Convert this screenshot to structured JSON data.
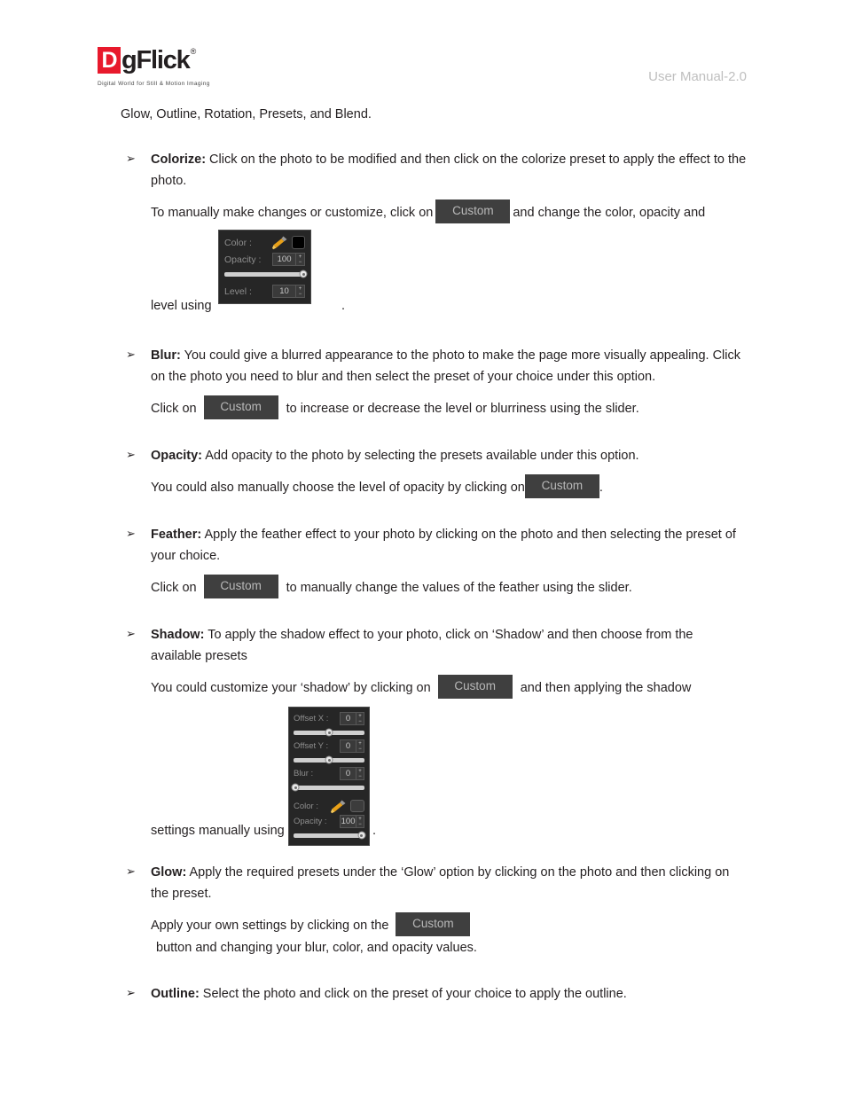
{
  "header": {
    "logo_letter": "D",
    "logo_text": "gFlick",
    "logo_reg": "®",
    "logo_tagline": "Digital World for Still & Motion Imaging",
    "manual_version": "User Manual-2.0"
  },
  "intro": {
    "text": "Glow, Outline, Rotation, Presets, and Blend."
  },
  "bullets": {
    "arrow_glyph": "➢",
    "colorize": {
      "title": "Colorize:",
      "body": " Click on the photo to be modified and then click on the colorize preset to apply the effect to the photo.",
      "sub_pre": "To manually make changes or customize, click on",
      "custom_label": "Custom",
      "sub_post": "and change the color, opacity and",
      "tail_pre": "level using",
      "tail_post": "."
    },
    "blur": {
      "title": "Blur:",
      "body": " You could give a blurred appearance to the photo to make the page more visually appealing. Click on the photo you need to blur and then select the preset of your choice under this option.",
      "sub_pre": "Click on",
      "custom_label": "Custom",
      "sub_post": "to increase or decrease the level or blurriness using the slider."
    },
    "opacity": {
      "title": "Opacity:",
      "body": " Add opacity to the photo by selecting the presets available under this option.",
      "sub_pre": "You could also manually choose the level of opacity by clicking on",
      "custom_label": "Custom",
      "sub_post": "."
    },
    "feather": {
      "title": "Feather:",
      "body": " Apply the feather effect to your photo by clicking on the photo and then selecting the preset of your choice.",
      "sub_pre": "Click on",
      "custom_label": "Custom",
      "sub_post": "to manually change the values of the feather using the slider."
    },
    "shadow": {
      "title": "Shadow:",
      "body": " To apply the shadow effect to your photo, click on ‘Shadow’ and then choose from the available presets",
      "sub_pre": "You could customize your ‘shadow’ by clicking on",
      "custom_label": "Custom",
      "sub_post": "and then applying the shadow",
      "tail_pre": "settings manually using",
      "tail_post": "."
    },
    "glow": {
      "title": "Glow:",
      "body": " Apply the required presets under the ‘Glow’ option by clicking on the photo and then clicking on the preset.",
      "sub_pre": "Apply your own settings by clicking on the",
      "custom_label": "Custom",
      "sub_post": "button and changing your blur, color, and opacity values."
    },
    "outline": {
      "title": "Outline:",
      "body": " Select the photo and click on the preset of your choice to apply the outline."
    }
  },
  "colorize_panel": {
    "color_label": "Color :",
    "color_swatch_hex": "#000000",
    "opacity_label": "Opacity :",
    "opacity_value": "100",
    "opacity_slider_pct": 98,
    "level_label": "Level :",
    "level_value": "10",
    "spin_up": "+",
    "spin_down": "−"
  },
  "shadow_panel": {
    "offset_x_label": "Offset X :",
    "offset_x_value": "0",
    "offset_x_slider_pct": 50,
    "offset_y_label": "Offset Y :",
    "offset_y_value": "0",
    "offset_y_slider_pct": 50,
    "blur_label": "Blur :",
    "blur_value": "0",
    "blur_slider_pct": 3,
    "color_label": "Color :",
    "color_swatch_hex": "#3c3c3c",
    "opacity_label": "Opacity :",
    "opacity_value": "100",
    "opacity_slider_pct": 96,
    "spin_up": "+",
    "spin_down": "−"
  },
  "colors": {
    "brand_red": "#e8192c",
    "panel_bg": "#262626",
    "custom_btn_bg": "#3f3f3f",
    "custom_btn_text": "#b9b9b9",
    "header_gray": "#bfbfbf",
    "text": "#231f20"
  }
}
